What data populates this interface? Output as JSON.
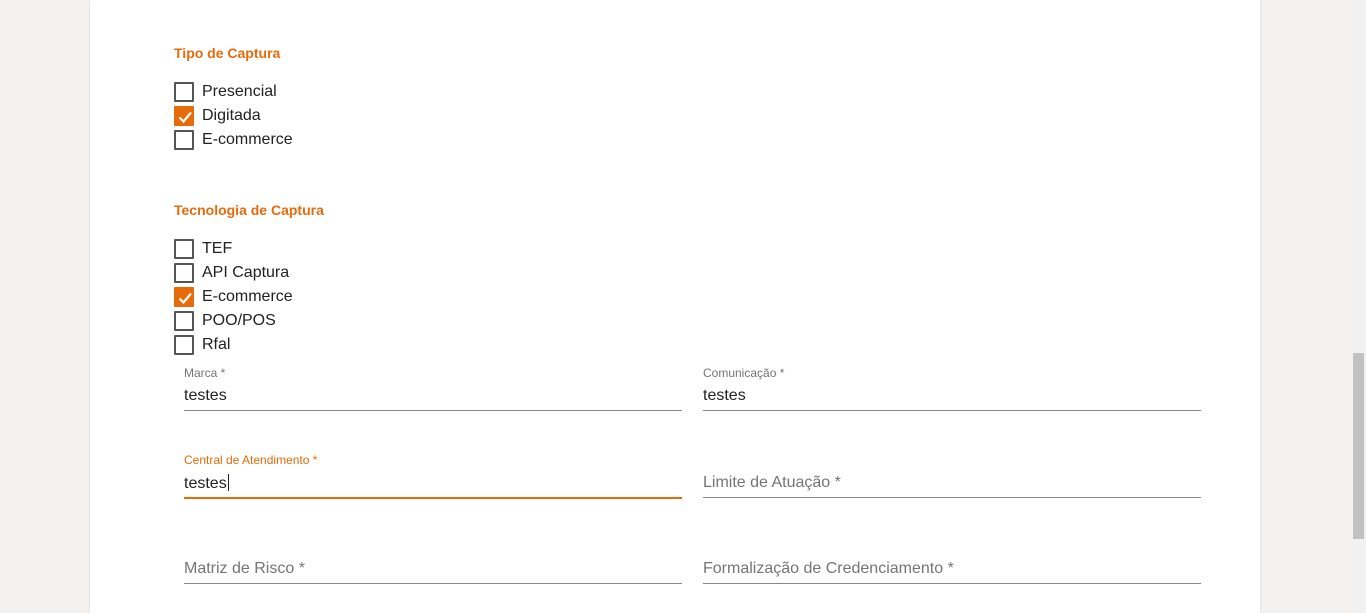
{
  "tipo_captura": {
    "title": "Tipo de Captura",
    "options": [
      {
        "label": "Presencial",
        "checked": false
      },
      {
        "label": "Digitada",
        "checked": true
      },
      {
        "label": "E-commerce",
        "checked": false
      }
    ]
  },
  "tecnologia_captura": {
    "title": "Tecnologia de Captura",
    "options": [
      {
        "label": "TEF",
        "checked": false
      },
      {
        "label": "API Captura",
        "checked": false
      },
      {
        "label": "E-commerce",
        "checked": true
      },
      {
        "label": "POO/POS",
        "checked": false
      },
      {
        "label": "Rfal",
        "checked": false
      }
    ]
  },
  "fields": {
    "marca": {
      "label": "Marca *",
      "value": "testes"
    },
    "comunicacao": {
      "label": "Comunicação *",
      "value": "testes"
    },
    "central_atendimento": {
      "label": "Central de Atendimento *",
      "value": "testes"
    },
    "limite_atuacao": {
      "placeholder": "Limite de Atuação *"
    },
    "matriz_risco": {
      "placeholder": "Matriz de Risco *"
    },
    "formalizacao": {
      "placeholder": "Formalização de Credenciamento *"
    }
  },
  "colors": {
    "accent": "#e66b0a",
    "text": "#222222",
    "muted": "#757575"
  }
}
